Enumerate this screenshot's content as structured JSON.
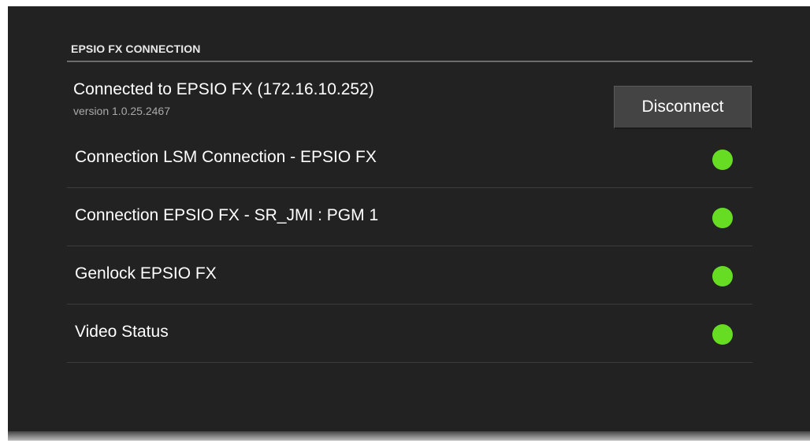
{
  "section": {
    "title": "EPSIO FX CONNECTION"
  },
  "connection": {
    "status_text": "Connected to EPSIO FX (172.16.10.252)",
    "version_text": "version 1.0.25.2467",
    "disconnect_label": "Disconnect"
  },
  "status_items": [
    {
      "label": "Connection LSM Connection - EPSIO FX",
      "state": "ok",
      "color": "#66dd22"
    },
    {
      "label": "Connection EPSIO FX - SR_JMI : PGM 1",
      "state": "ok",
      "color": "#66dd22"
    },
    {
      "label": "Genlock EPSIO FX",
      "state": "ok",
      "color": "#66dd22"
    },
    {
      "label": "Video Status",
      "state": "ok",
      "color": "#66dd22"
    }
  ],
  "colors": {
    "background": "#222222",
    "status_ok": "#66dd22"
  }
}
